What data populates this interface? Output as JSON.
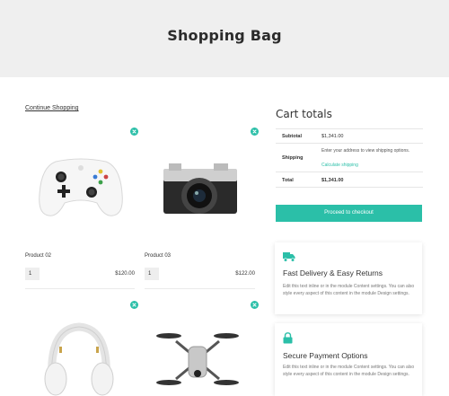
{
  "header": {
    "title": "Shopping Bag"
  },
  "nav": {
    "continue_label": "Continue Shopping"
  },
  "cart": {
    "items": [
      {
        "name": "Product 02",
        "qty": "1",
        "price": "$120.00",
        "image": "game-controller"
      },
      {
        "name": "Product 03",
        "qty": "1",
        "price": "$122.00",
        "image": "camera"
      },
      {
        "image": "headphones"
      },
      {
        "image": "drone"
      }
    ]
  },
  "totals": {
    "title": "Cart totals",
    "subtotal_label": "Subtotal",
    "subtotal_value": "$1,341.00",
    "shipping_label": "Shipping",
    "shipping_note": "Enter your address to view shipping options.",
    "shipping_link": "Calculate shipping",
    "total_label": "Total",
    "total_value": "$1,341.00",
    "checkout_label": "Proceed to checkout"
  },
  "features": [
    {
      "icon": "truck-icon",
      "title": "Fast Delivery & Easy Returns",
      "body": "Edit this text inline or in the module Content settings. You can also style every aspect of this content in the module Design settings."
    },
    {
      "icon": "lock-icon",
      "title": "Secure Payment Options",
      "body": "Edit this text inline or in the module Content settings. You can also style every aspect of this content in the module Design settings."
    }
  ],
  "colors": {
    "accent": "#2bbfa8",
    "hero_bg": "#efefef"
  }
}
